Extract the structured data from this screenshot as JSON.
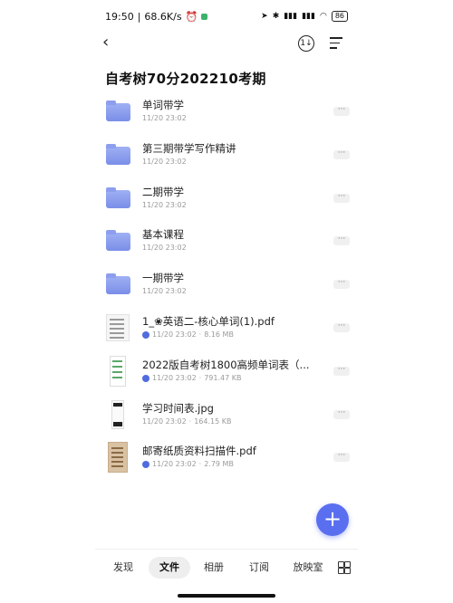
{
  "status_bar": {
    "time": "19:50",
    "speed": "68.6K/s",
    "battery": "86"
  },
  "header": {
    "title": "自考树70分202210考期"
  },
  "files": [
    {
      "name": "单词带学",
      "meta": "11/20 23:02",
      "size": "",
      "type": "folder"
    },
    {
      "name": "第三期带学写作精讲",
      "meta": "11/20 23:02",
      "size": "",
      "type": "folder"
    },
    {
      "name": "二期带学",
      "meta": "11/20 23:02",
      "size": "",
      "type": "folder"
    },
    {
      "name": "基本课程",
      "meta": "11/20 23:02",
      "size": "",
      "type": "folder"
    },
    {
      "name": "一期带学",
      "meta": "11/20 23:02",
      "size": "",
      "type": "folder"
    },
    {
      "name": "1_❀英语二-核心单词(1).pdf",
      "meta": "11/20 23:02",
      "size": "8.16 MB",
      "type": "pdf"
    },
    {
      "name": "2022版自考树1800高频单词表（...",
      "meta": "11/20 23:02",
      "size": "791.47 KB",
      "type": "sheet"
    },
    {
      "name": "学习时间表.jpg",
      "meta": "11/20 23:02",
      "size": "164.15 KB",
      "type": "jpg"
    },
    {
      "name": "邮寄纸质资料扫描件.pdf",
      "meta": "11/20 23:02",
      "size": "2.79 MB",
      "type": "scan"
    }
  ],
  "more_label": "···",
  "sort_label": "1↓",
  "fab_label": "+",
  "back_label": "‹",
  "tabs": [
    "发现",
    "文件",
    "相册",
    "订阅",
    "放映室"
  ],
  "active_tab": "文件",
  "colors": {
    "accent": "#5a6ef0",
    "folder": "#8d9eef"
  }
}
